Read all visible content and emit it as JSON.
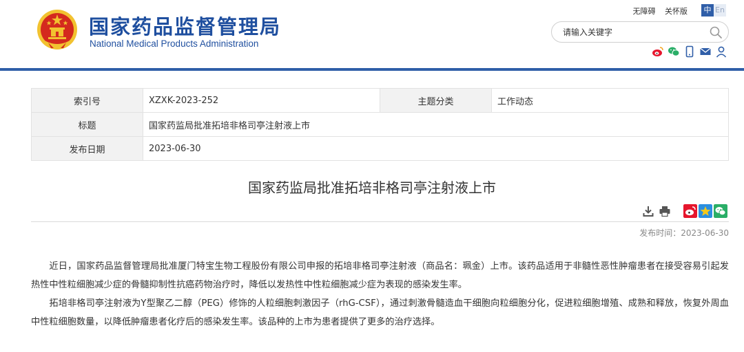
{
  "header": {
    "title_cn": "国家药品监督管理局",
    "title_en": "National Medical Products Administration",
    "accessibility_label": "无障碍",
    "care_mode_label": "关怀版",
    "lang_cn": "中",
    "lang_en": "En",
    "search_placeholder": "请输入关键字",
    "share_icons": [
      "weibo-icon",
      "wechat-icon",
      "mobile-icon",
      "mail-icon",
      "user-icon"
    ]
  },
  "meta": {
    "index_label": "索引号",
    "index_value": "XZXK-2023-252",
    "topic_label": "主题分类",
    "topic_value": "工作动态",
    "title_label": "标题",
    "title_value": "国家药监局批准拓培非格司亭注射液上市",
    "date_label": "发布日期",
    "date_value": "2023-06-30"
  },
  "article": {
    "title": "国家药监局批准拓培非格司亭注射液上市",
    "publish_time": "发布时间：2023-06-30",
    "paragraphs": [
      "近日，国家药品监督管理局批准厦门特宝生物工程股份有限公司申报的拓培非格司亭注射液（商品名：珮金）上市。该药品适用于非髓性恶性肿瘤患者在接受容易引起发热性中性粒细胞减少症的骨髓抑制性抗癌药物治疗时，降低以发热性中性粒细胞减少症为表现的感染发生率。",
      "拓培非格司亭注射液为Y型聚乙二醇（PEG）修饰的人粒细胞刺激因子（rhG-CSF），通过刺激骨髓造血干细胞向粒细胞分化，促进粒细胞增殖、成熟和释放，恢复外周血中性粒细胞数量，以降低肿瘤患者化疗后的感染发生率。该品种的上市为患者提供了更多的治疗选择。"
    ],
    "tool_icons": [
      "download-icon",
      "print-icon",
      "weibo-share-icon",
      "qzone-share-icon",
      "wechat-share-icon"
    ]
  },
  "colors": {
    "brand_blue": "#2f5ea8",
    "emblem_red": "#d42a1e",
    "emblem_gold": "#f2c230"
  }
}
